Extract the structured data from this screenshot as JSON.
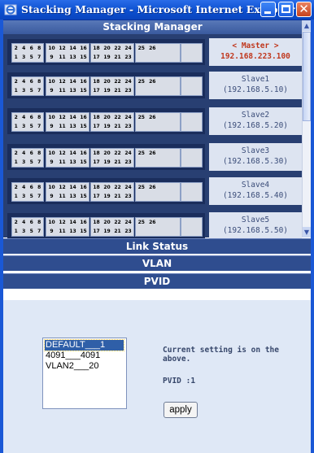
{
  "window": {
    "title": "Stacking Manager - Microsoft Internet Explorer"
  },
  "panel": {
    "header": "Stacking Manager"
  },
  "ports": {
    "top": [
      "2",
      "4",
      "6",
      "8",
      "10",
      "12",
      "14",
      "16",
      "18",
      "20",
      "22",
      "24",
      "25",
      "26"
    ],
    "bottom": [
      "1",
      "3",
      "5",
      "7",
      "9",
      "11",
      "13",
      "15",
      "17",
      "19",
      "21",
      "23"
    ]
  },
  "units": [
    {
      "name": "< Master >",
      "ip": "192.168.223.100",
      "role": "master"
    },
    {
      "name": "Slave1",
      "ip": "(192.168.5.10)",
      "role": "slave"
    },
    {
      "name": "Slave2",
      "ip": "(192.168.5.20)",
      "role": "slave"
    },
    {
      "name": "Slave3",
      "ip": "(192.168.5.30)",
      "role": "slave"
    },
    {
      "name": "Slave4",
      "ip": "(192.168.5.40)",
      "role": "slave"
    },
    {
      "name": "Slave5",
      "ip": "(192.168.5.50)",
      "role": "slave"
    }
  ],
  "sections": {
    "link_status": "Link Status",
    "vlan": "VLAN",
    "pvid": "PVID"
  },
  "pvid": {
    "vlans": [
      {
        "label": "DEFAULT___1",
        "selected": true
      },
      {
        "label": "4091___4091",
        "selected": false
      },
      {
        "label": "VLAN2___20",
        "selected": false
      }
    ],
    "current_setting": "Current setting is on the above.",
    "pvid_text": "PVID :1",
    "apply_label": "apply"
  },
  "colors": {
    "panel": "#283f72",
    "master_accent": "#c0381e",
    "section_bar": "#2f4d8f",
    "pvid_bg": "#dfe8f6"
  }
}
